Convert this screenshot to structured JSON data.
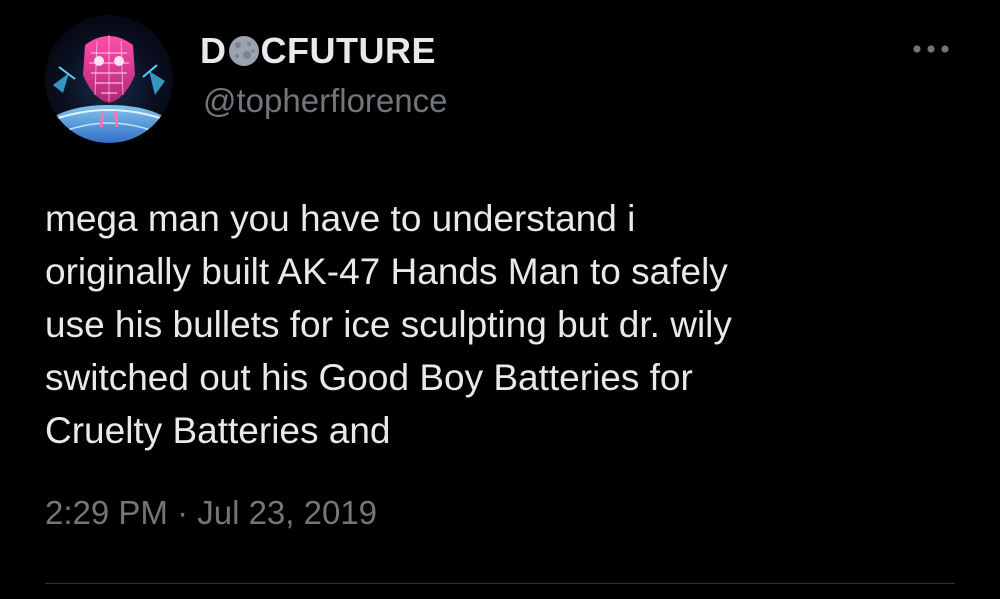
{
  "tweet": {
    "author": {
      "display_name_prefix": "D",
      "display_name_emoji": "moon-icon",
      "display_name_suffix": "CFUTURE",
      "handle": "@topherflorence",
      "avatar_icon": "neon-face-avatar"
    },
    "more_icon": "more-options-icon",
    "text": "mega man you have to understand i\noriginally built AK-47 Hands Man to safely\nuse his bullets for ice sculpting but dr. wily\nswitched out his Good Boy Batteries for\nCruelty Batteries and",
    "timestamp": "2:29 PM · Jul 23, 2019"
  },
  "colors": {
    "background": "#000000",
    "primary_text": "#e7e9ea",
    "secondary_text": "#71767b",
    "divider": "#2f3336"
  }
}
